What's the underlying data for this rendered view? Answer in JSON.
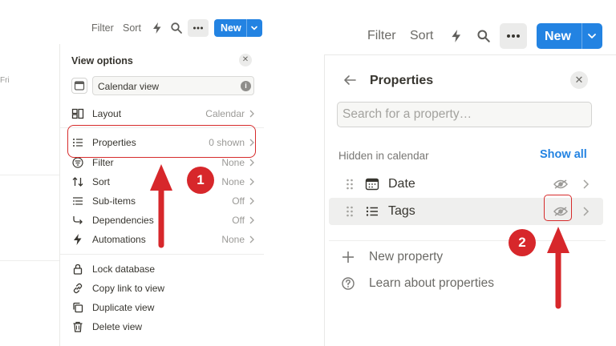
{
  "left": {
    "toolbar": {
      "filter_label": "Filter",
      "sort_label": "Sort",
      "new_label": "New"
    },
    "calendar": {
      "day_label": "Fri"
    },
    "view_options": {
      "title": "View options",
      "view_name_value": "Calendar view",
      "items": [
        {
          "label": "Layout",
          "value": "Calendar",
          "icon": "layout-icon"
        },
        {
          "label": "Properties",
          "value": "0 shown",
          "icon": "list-icon"
        },
        {
          "label": "Filter",
          "value": "None",
          "icon": "filter-icon"
        },
        {
          "label": "Sort",
          "value": "None",
          "icon": "sort-icon"
        },
        {
          "label": "Sub-items",
          "value": "Off",
          "icon": "sub-items-icon"
        },
        {
          "label": "Dependencies",
          "value": "Off",
          "icon": "dependencies-icon"
        },
        {
          "label": "Automations",
          "value": "None",
          "icon": "lightning-icon"
        }
      ],
      "actions": [
        {
          "label": "Lock database",
          "icon": "lock-icon"
        },
        {
          "label": "Copy link to view",
          "icon": "link-icon"
        },
        {
          "label": "Duplicate view",
          "icon": "duplicate-icon"
        },
        {
          "label": "Delete view",
          "icon": "trash-icon"
        }
      ]
    },
    "step_badge": "1"
  },
  "right": {
    "toolbar": {
      "filter_label": "Filter",
      "sort_label": "Sort",
      "new_label": "New"
    },
    "properties_panel": {
      "title": "Properties",
      "search_placeholder": "Search for a property…",
      "section_label": "Hidden in calendar",
      "show_all_label": "Show all",
      "properties": [
        {
          "label": "Date",
          "icon": "calendar-icon",
          "visibility_icon": "eye-icon"
        },
        {
          "label": "Tags",
          "icon": "list-icon",
          "visibility_icon": "eye-icon"
        }
      ],
      "footer": [
        {
          "label": "New property",
          "icon": "plus-icon"
        },
        {
          "label": "Learn about properties",
          "icon": "question-icon"
        }
      ]
    },
    "step_badge": "2"
  },
  "colors": {
    "accent_blue": "#2383e2",
    "annotation_red": "#d7272b",
    "text_primary": "#37352f",
    "text_muted": "#9b9a97"
  }
}
